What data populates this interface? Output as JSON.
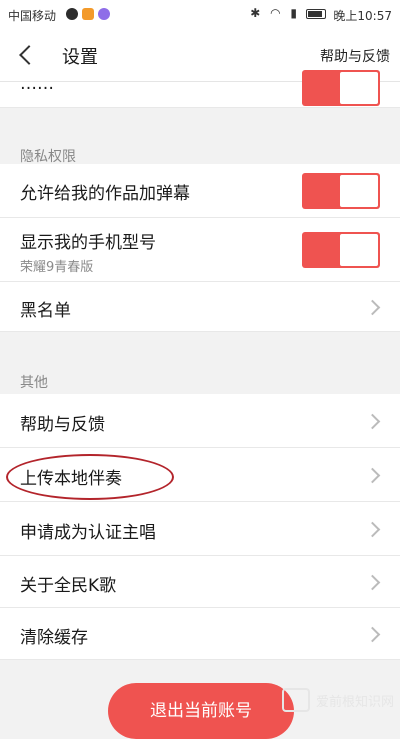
{
  "status_bar": {
    "carrier": "中国移动",
    "time": "晚上10:57",
    "icons": [
      "signal-icon",
      "notification-icon",
      "app-icon",
      "bluetooth-icon",
      "wifi-icon",
      "4g-icon",
      "battery-icon"
    ],
    "accent_colors": [
      "#2c2c2c",
      "#f39a2a",
      "#8e6de8"
    ]
  },
  "navbar": {
    "title": "设置",
    "help_link": "帮助与反馈"
  },
  "partial_row": {
    "label_fragment": "……"
  },
  "privacy_section": {
    "title": "隐私权限",
    "rows": [
      {
        "label": "允许给我的作品加弹幕",
        "toggle_on": true
      },
      {
        "label": "显示我的手机型号",
        "sub": "荣耀9青春版",
        "toggle_on": true
      },
      {
        "label": "黑名单"
      }
    ]
  },
  "other_section": {
    "title": "其他",
    "rows": [
      {
        "label": "帮助与反馈"
      },
      {
        "label": "上传本地伴奏"
      },
      {
        "label": "申请成为认证主唱"
      },
      {
        "label": "关于全民K歌"
      },
      {
        "label": "清除缓存"
      }
    ]
  },
  "logout_button": "退出当前账号",
  "watermark": "爱前根知识网",
  "colors": {
    "accent": "#ef5350",
    "annotation": "#b3242b",
    "background": "#f2f2f2"
  }
}
